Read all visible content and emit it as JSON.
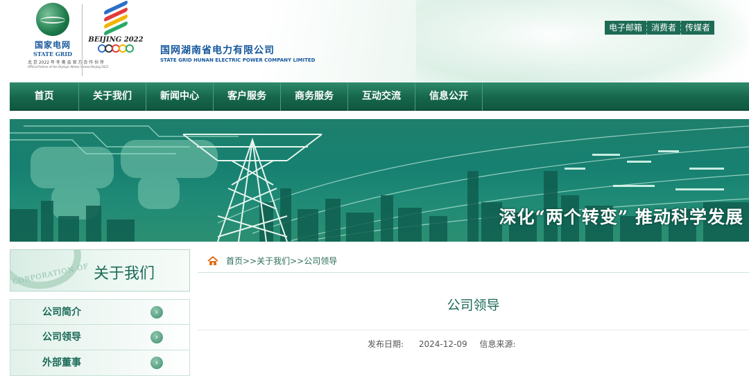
{
  "header": {
    "logo": {
      "name_cn": "国家电网",
      "name_en": "STATE GRID",
      "tagline_cn": "北 京 2022 年 冬 奥 会 官 方 合 作 伙 伴",
      "tagline_en": "Official Partner of the Olympic Winter Games Beijing 2022",
      "olympic_text": "BEIJING 2022"
    },
    "company_cn": "国网湖南省电力有限公司",
    "company_en": "STATE GRID HUNAN ELECTRIC POWER COMPANY LIMITED",
    "top_links": [
      "电子邮箱",
      "消费者",
      "传媒者"
    ]
  },
  "nav": {
    "items": [
      "首页",
      "关于我们",
      "新闻中心",
      "客户服务",
      "商务服务",
      "互动交流",
      "信息公开"
    ]
  },
  "banner": {
    "slogan": "深化“两个转变” 推动科学发展"
  },
  "sidebar": {
    "title": "关于我们",
    "emblem_text": "CORPORATION OF",
    "items": [
      {
        "label": "公司简介"
      },
      {
        "label": "公司领导"
      },
      {
        "label": "外部董事"
      }
    ]
  },
  "breadcrumb": {
    "text": "首页>>关于我们>>公司领导"
  },
  "article": {
    "title": "公司领导",
    "date_label": "发布日期:",
    "date": "2024-12-09",
    "source_label": "信息来源:"
  },
  "colors": {
    "brand_green": "#16664b",
    "brand_blue": "#14569c",
    "nav_text": "#ffffff"
  }
}
